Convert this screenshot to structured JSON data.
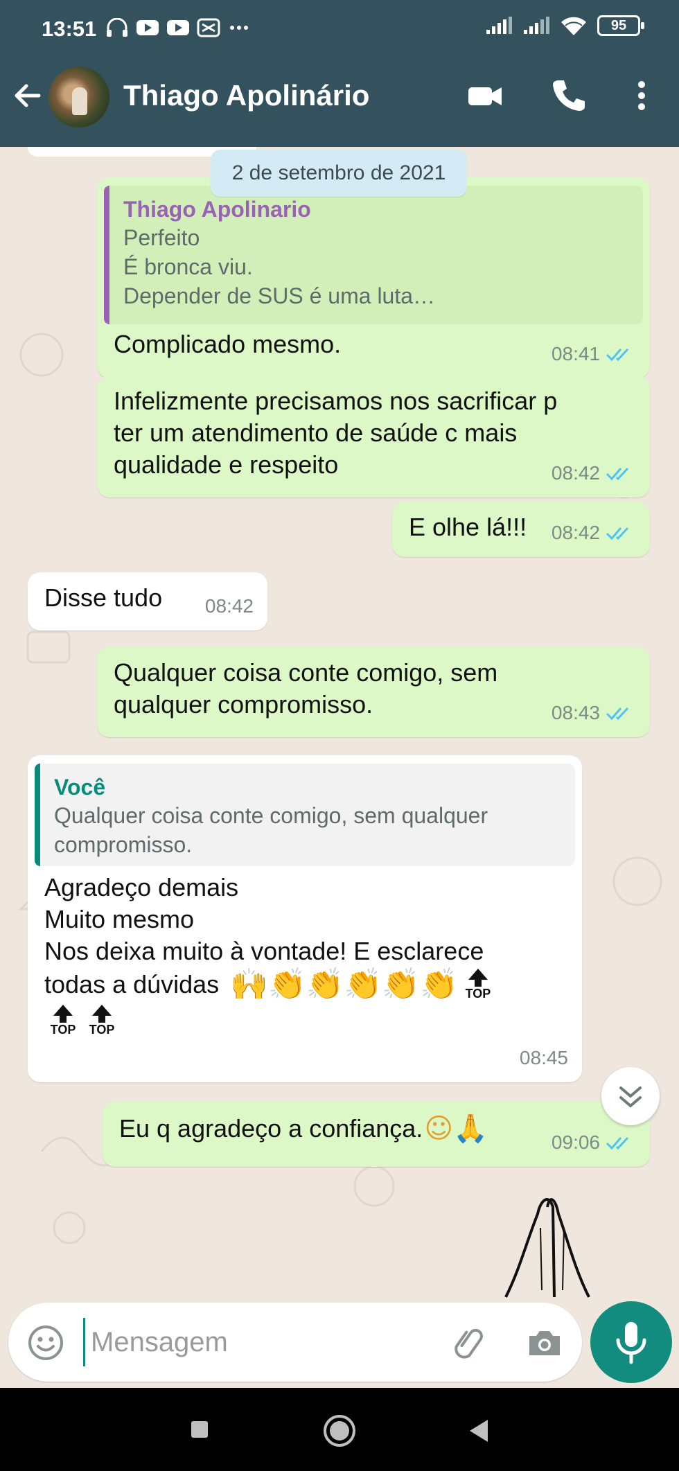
{
  "status_bar": {
    "time": "13:51",
    "icons": [
      "headphones-icon",
      "youtube-icon",
      "youtube-icon",
      "capcut-icon",
      "more-dots-icon"
    ],
    "battery": "95"
  },
  "header": {
    "contact_name": "Thiago Apolinário",
    "icons": [
      "back-arrow-icon",
      "video-call-icon",
      "phone-icon",
      "menu-dots-icon"
    ]
  },
  "chat": {
    "date_chip": "2 de setembro de 2021",
    "messages": [
      {
        "direction": "out",
        "quote": {
          "author": "Thiago Apolinario",
          "lines": [
            "Perfeito",
            "É bronca viu.",
            "Depender de SUS é uma luta…"
          ]
        },
        "text": "Complicado mesmo.",
        "time": "08:41",
        "status": "read"
      },
      {
        "direction": "out",
        "lines": [
          "Infelizmente precisamos nos sacrificar p",
          "ter um atendimento de saúde c mais",
          "qualidade e respeito"
        ],
        "time": "08:42",
        "status": "read"
      },
      {
        "direction": "out",
        "text": "E olhe lá!!!",
        "time": "08:42",
        "status": "read"
      },
      {
        "direction": "in",
        "text": "Disse tudo",
        "time": "08:42"
      },
      {
        "direction": "out",
        "lines": [
          "Qualquer coisa conte comigo, sem",
          "qualquer compromisso."
        ],
        "time": "08:43",
        "status": "read"
      },
      {
        "direction": "in",
        "quote": {
          "author": "Você",
          "lines": [
            "Qualquer coisa conte comigo, sem qualquer",
            "compromisso."
          ]
        },
        "lines": [
          "Agradeço demais",
          "Muito mesmo",
          "Nos deixa muito à vontade! E esclarece",
          "todas a dúvidas"
        ],
        "emoji": "🙌👏👏👏👏👏",
        "top_label": "TOP",
        "time": "08:45"
      },
      {
        "direction": "out",
        "text": "Eu q agradeço a confiança.",
        "emoji": "☺🙏",
        "time": "09:06",
        "status": "read"
      }
    ],
    "sticker": "praying-hands-sticker"
  },
  "composer": {
    "placeholder": "Mensagem",
    "icons": [
      "emoji-icon",
      "attach-icon",
      "camera-icon",
      "mic-icon"
    ]
  },
  "nav_bar": {
    "icons": [
      "recents-square-icon",
      "home-circle-icon",
      "back-triangle-icon"
    ]
  },
  "colors": {
    "header": "#34525e",
    "outgoing_bubble": "#dcf8c6",
    "incoming_bubble": "#ffffff",
    "chat_background": "#efe7de",
    "read_ticks": "#4fc3f7",
    "accent": "#128c7e",
    "quote_author_purple": "#9a62b3",
    "quote_author_teal": "#0a8a7a"
  }
}
